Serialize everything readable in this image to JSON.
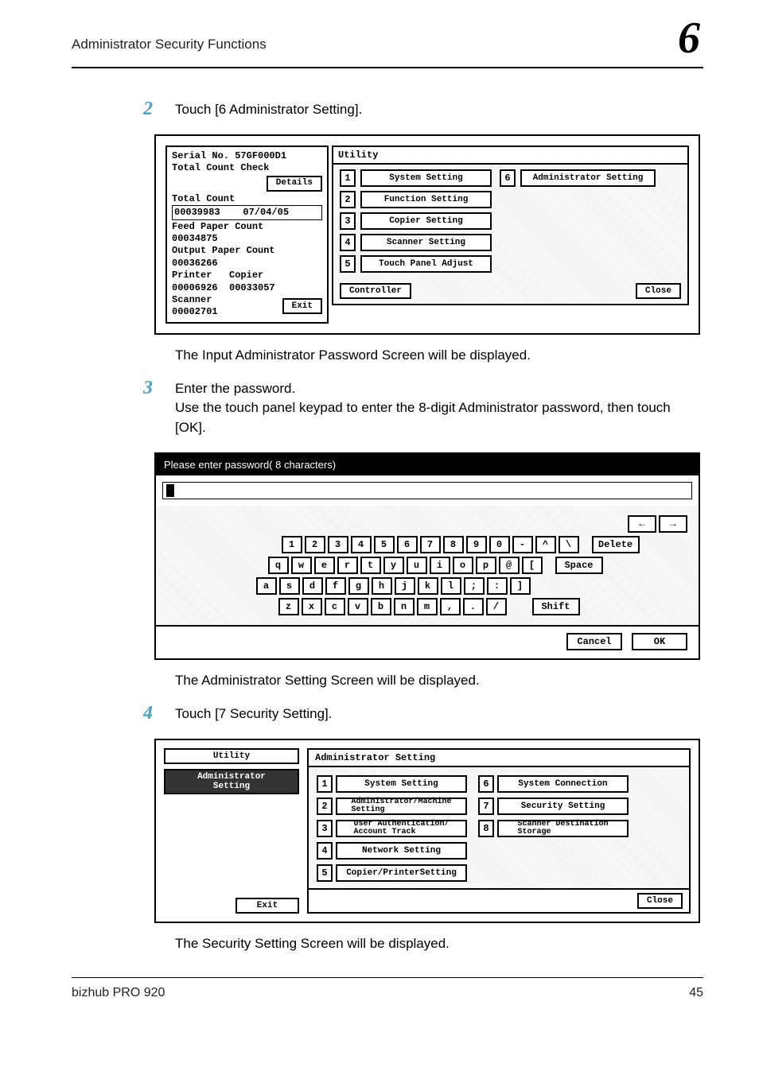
{
  "header": {
    "section_title": "Administrator Security Functions",
    "chapter_number": "6"
  },
  "steps": {
    "s2": {
      "num": "2",
      "text": "Touch [6 Administrator Setting].",
      "after_caption": "The Input Administrator Password Screen will be displayed."
    },
    "s3": {
      "num": "3",
      "text_line1": "Enter the password.",
      "text_line2": "Use the touch panel keypad to enter the 8-digit Administrator password, then touch [OK].",
      "after_caption": "The Administrator Setting Screen will be displayed."
    },
    "s4": {
      "num": "4",
      "text": "Touch [7 Security Setting].",
      "after_caption": "The Security Setting Screen will be displayed."
    }
  },
  "utility_panel": {
    "left": {
      "serial_line": "Serial No. 57GF000D1",
      "total_count_check": "Total Count Check",
      "details_btn": "Details",
      "total_count_label": "Total Count",
      "total_count_value": "00039983    07/04/05",
      "feed_label": "Feed Paper Count",
      "feed_value": "00034875",
      "output_label": "Output Paper Count",
      "output_value": "00036266",
      "printer_copier_label": "Printer   Copier",
      "printer_copier_value": "00006926  00033057",
      "scanner_label": "Scanner",
      "scanner_value": "00002701",
      "exit_btn": "Exit"
    },
    "right": {
      "title": "Utility",
      "items": [
        {
          "num": "1",
          "label": "System Setting"
        },
        {
          "num": "2",
          "label": "Function Setting"
        },
        {
          "num": "3",
          "label": "Copier Setting"
        },
        {
          "num": "4",
          "label": "Scanner Setting"
        },
        {
          "num": "5",
          "label": "Touch Panel Adjust"
        }
      ],
      "item6_num": "6",
      "item6_label": "Administrator Setting",
      "controller_btn": "Controller",
      "close_btn": "Close"
    }
  },
  "keyboard_panel": {
    "prompt": "Please enter password( 8 characters)",
    "arrow_left": "←",
    "arrow_right": "→",
    "row_nums": [
      "1",
      "2",
      "3",
      "4",
      "5",
      "6",
      "7",
      "8",
      "9",
      "0",
      "-",
      "^",
      "\\"
    ],
    "delete": "Delete",
    "row_q": [
      "q",
      "w",
      "e",
      "r",
      "t",
      "y",
      "u",
      "i",
      "o",
      "p",
      "@",
      "["
    ],
    "space": "Space",
    "row_a": [
      "a",
      "s",
      "d",
      "f",
      "g",
      "h",
      "j",
      "k",
      "l",
      ";",
      ":",
      "]"
    ],
    "row_z": [
      "z",
      "x",
      "c",
      "v",
      "b",
      "n",
      "m",
      ",",
      ".",
      "/"
    ],
    "shift": "Shift",
    "cancel": "Cancel",
    "ok": "OK"
  },
  "admin_panel": {
    "left": {
      "utility_btn": "Utility",
      "admin_setting_line1": "Administrator",
      "admin_setting_line2": "Setting",
      "exit_btn": "Exit"
    },
    "right": {
      "title": "Administrator Setting",
      "col1": [
        {
          "num": "1",
          "label": "System Setting"
        },
        {
          "num": "2",
          "label": "Administrator/Machine\nSetting"
        },
        {
          "num": "3",
          "label": "User Authentication/\nAccount Track"
        },
        {
          "num": "4",
          "label": "Network Setting"
        },
        {
          "num": "5",
          "label": "Copier/PrinterSetting"
        }
      ],
      "col2": [
        {
          "num": "6",
          "label": "System Connection"
        },
        {
          "num": "7",
          "label": "Security Setting"
        },
        {
          "num": "8",
          "label": "Scanner Destination\nStorage"
        }
      ],
      "close": "Close"
    }
  },
  "footer": {
    "product": "bizhub PRO 920",
    "page": "45"
  }
}
